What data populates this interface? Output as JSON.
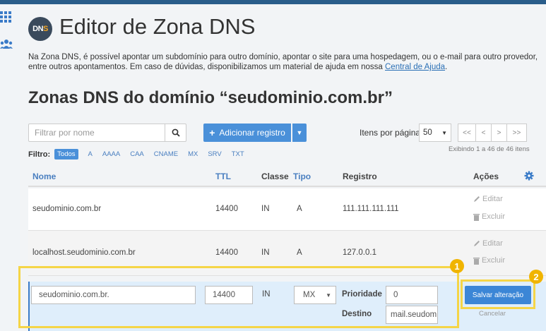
{
  "header": {
    "title": "Editor de Zona DNS"
  },
  "description": {
    "line1": "Na Zona DNS, é possível apontar um subdomínio para outro domínio, apontar o site para uma hospedagem, ou o e-mail para outro provedor,",
    "line2_prefix": "entre outros apontamentos. Em caso de dúvidas, disponibilizamos um material de ajuda em nossa ",
    "link": "Central de Ajuda",
    "line2_suffix": "."
  },
  "subtitle": "Zonas DNS do domínio “seudominio.com.br”",
  "toolbar": {
    "filter_placeholder": "Filtrar por nome",
    "add_label": "Adicionar registro",
    "per_page_label": "Itens por página",
    "per_page_value": "50",
    "pager": [
      "<<",
      "<",
      ">",
      ">>"
    ]
  },
  "filter": {
    "label": "Filtro:",
    "chips": [
      "Todos",
      "A",
      "AAAA",
      "CAA",
      "CNAME",
      "MX",
      "SRV",
      "TXT"
    ],
    "active": "Todos"
  },
  "showing": "Exibindo 1 a 46 de 46 itens",
  "table": {
    "headers": {
      "name": "Nome",
      "ttl": "TTL",
      "class": "Classe",
      "type": "Tipo",
      "record": "Registro",
      "actions": "Ações"
    },
    "rows": [
      {
        "name": "seudominio.com.br",
        "ttl": "14400",
        "class": "IN",
        "type": "A",
        "record": "111.111.111.111",
        "edit": "Editar",
        "delete": "Excluir"
      },
      {
        "name": "localhost.seudominio.com.br",
        "ttl": "14400",
        "class": "IN",
        "type": "A",
        "record": "127.0.0.1",
        "edit": "Editar",
        "delete": "Excluir"
      }
    ],
    "edit_row": {
      "name": "seudominio.com.br.",
      "ttl": "14400",
      "class": "IN",
      "type": "MX",
      "priority_label": "Prioridade",
      "priority_value": "0",
      "dest_label": "Destino",
      "dest_value": "mail.seudominio.com.br",
      "save_label": "Salvar alteração",
      "cancel_label": "Cancelar"
    }
  },
  "badges": [
    "1",
    "2"
  ],
  "colors": {
    "accent": "#4a90d9",
    "highlight": "#f5d547",
    "badge": "#f0b400"
  }
}
